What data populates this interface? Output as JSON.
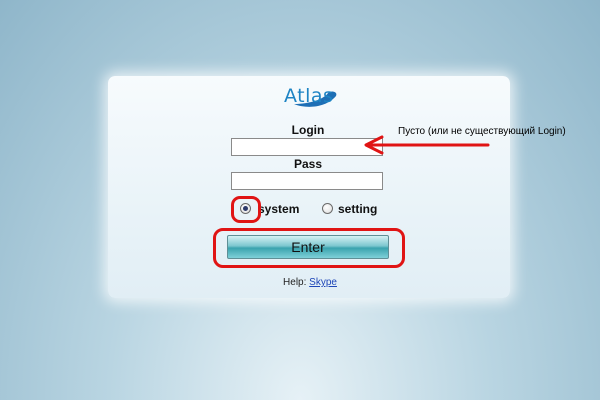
{
  "logo": {
    "text": "Atlas"
  },
  "login": {
    "label": "Login",
    "value": "",
    "placeholder": ""
  },
  "pass": {
    "label": "Pass",
    "value": "",
    "placeholder": ""
  },
  "mode": {
    "options": [
      {
        "label": "system",
        "checked": true
      },
      {
        "label": "setting",
        "checked": false
      }
    ]
  },
  "enter_button": {
    "label": "Enter"
  },
  "help": {
    "prefix": "Help:",
    "link": "Skype"
  },
  "annotation": {
    "text": "Пусто (или не существующий Login)",
    "color": "#e01414"
  },
  "colors": {
    "logo": "#1e84c4",
    "link": "#1f47b8",
    "button_accent": "#3aa3ae"
  }
}
